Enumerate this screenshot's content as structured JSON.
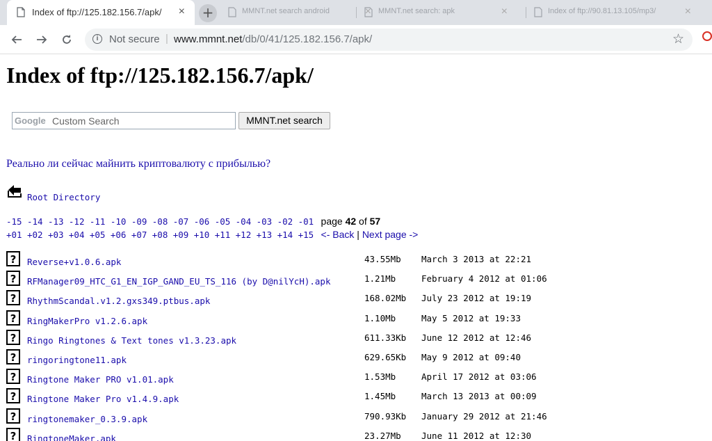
{
  "browser": {
    "tabs": [
      {
        "title": "Index of ftp://125.182.156.7/apk/",
        "active": true
      },
      {
        "title": "MMNT.net search android",
        "active": false
      },
      {
        "title": "MMNT.net search: apk",
        "active": false
      },
      {
        "title": "Index of ftp://90.81.13.105/mp3/",
        "active": false
      }
    ],
    "new_tab_label": "+",
    "not_secure": "Not secure",
    "url_host": "www.mmnt.net",
    "url_path": "/db/0/41/125.182.156.7/apk/",
    "icons": [
      "back-arrow-icon",
      "forward-arrow-icon",
      "reload-icon",
      "info-icon",
      "star-icon",
      "profile-icon"
    ]
  },
  "page": {
    "title": "Index of ftp://125.182.156.7/apk/",
    "search": {
      "brand": "Google",
      "placeholder": "Custom Search",
      "button_label": "MMNT.net search"
    },
    "promo_link": "Реально ли сейчас майнить криптовалюту с прибылью?",
    "root_link": "Root Directory",
    "pager": {
      "prev_pages": [
        "-15",
        "-14",
        "-13",
        "-12",
        "-11",
        "-10",
        "-09",
        "-08",
        "-07",
        "-06",
        "-05",
        "-04",
        "-03",
        "-02",
        "-01"
      ],
      "next_pages": [
        "+01",
        "+02",
        "+03",
        "+04",
        "+05",
        "+06",
        "+07",
        "+08",
        "+09",
        "+10",
        "+11",
        "+12",
        "+13",
        "+14",
        "+15"
      ],
      "page_word": "page",
      "current": "42",
      "of_word": "of",
      "total": "57",
      "back_label": "<- Back",
      "separator": "|",
      "next_label": "Next page ->"
    },
    "files": [
      {
        "name": "Reverse+v1.0.6.apk",
        "size": "43.55Mb",
        "date": "March 3 2013 at 22:21"
      },
      {
        "name": "RFManager09_HTC_G1_EN_IGP_GAND_EU_TS_116 (by D@nilYcH).apk",
        "size": "1.21Mb",
        "date": "February 4 2012 at 01:06"
      },
      {
        "name": "RhythmScandal.v1.2.gxs349.ptbus.apk",
        "size": "168.02Mb",
        "date": "July 23 2012 at 19:19"
      },
      {
        "name": "RingMakerPro v1.2.6.apk",
        "size": "1.10Mb",
        "date": "May 5 2012 at 19:33"
      },
      {
        "name": "Ringo Ringtones & Text tones v1.3.23.apk",
        "size": "611.33Kb",
        "date": "June 12 2012 at 12:46"
      },
      {
        "name": "ringoringtone11.apk",
        "size": "629.65Kb",
        "date": "May 9 2012 at 09:40"
      },
      {
        "name": "Ringtone Maker PRO v1.01.apk",
        "size": "1.53Mb",
        "date": "April 17 2012 at 03:06"
      },
      {
        "name": "Ringtone Maker Pro v1.4.9.apk",
        "size": "1.45Mb",
        "date": "March 13 2013 at 00:09"
      },
      {
        "name": "ringtonemaker_0.3.9.apk",
        "size": "790.93Kb",
        "date": "January 29 2012 at 21:46"
      },
      {
        "name": "RingtoneMaker.apk",
        "size": "23.27Mb",
        "date": "June 11 2012 at 12:30"
      }
    ]
  }
}
